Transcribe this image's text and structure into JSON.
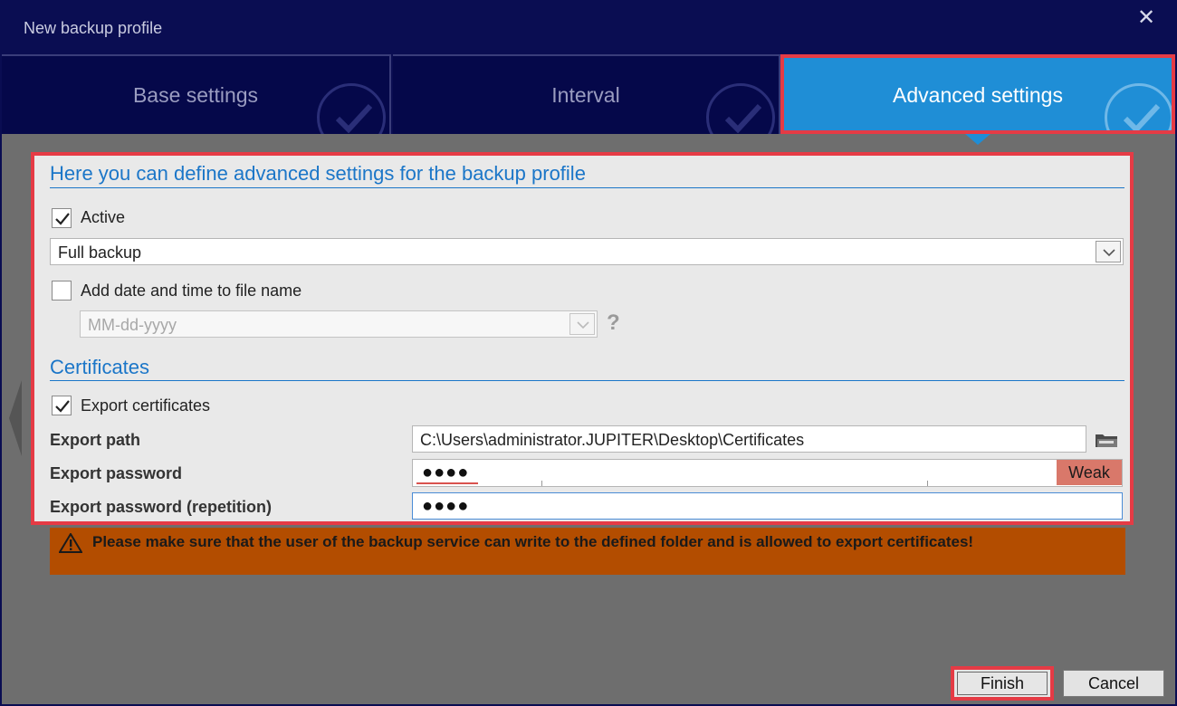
{
  "window": {
    "title": "New backup profile",
    "close_symbol": "✕"
  },
  "tabs": [
    {
      "label": "Base settings",
      "active": false,
      "check_icon": "checkmark-icon"
    },
    {
      "label": "Interval",
      "active": false,
      "check_icon": "checkmark-icon"
    },
    {
      "label": "Advanced settings",
      "active": true,
      "check_icon": "checkmark-icon"
    }
  ],
  "advanced": {
    "heading": "Here you can define advanced settings for the backup profile",
    "active": {
      "label": "Active",
      "checked": true
    },
    "backup_type": {
      "selected": "Full backup"
    },
    "add_date": {
      "label": "Add date and time to file name",
      "checked": false
    },
    "date_format": {
      "placeholder": "MM-dd-yyyy",
      "disabled": true
    },
    "help_symbol": "?"
  },
  "certificates": {
    "heading": "Certificates",
    "export": {
      "label": "Export certificates",
      "checked": true
    },
    "path_label": "Export path",
    "path_value": "C:\\Users\\administrator.JUPITER\\Desktop\\Certificates",
    "password_label": "Export password",
    "password_mask": "●●●●",
    "strength": "Weak",
    "repeat_label": "Export password (repetition)",
    "repeat_mask": "●●●●"
  },
  "warning": {
    "icon": "warning-icon",
    "text": "Please make sure that the user of the backup service can write to the defined folder and is allowed to export certificates!"
  },
  "footer": {
    "finish_label": "Finish",
    "cancel_label": "Cancel"
  },
  "colors": {
    "window_bg": "#0a0d52",
    "accent": "#1f8ed6",
    "highlight": "#e53b45",
    "section_title": "#1b76c8",
    "warning_bg": "#b34d00",
    "weak_badge": "#d9786a"
  }
}
